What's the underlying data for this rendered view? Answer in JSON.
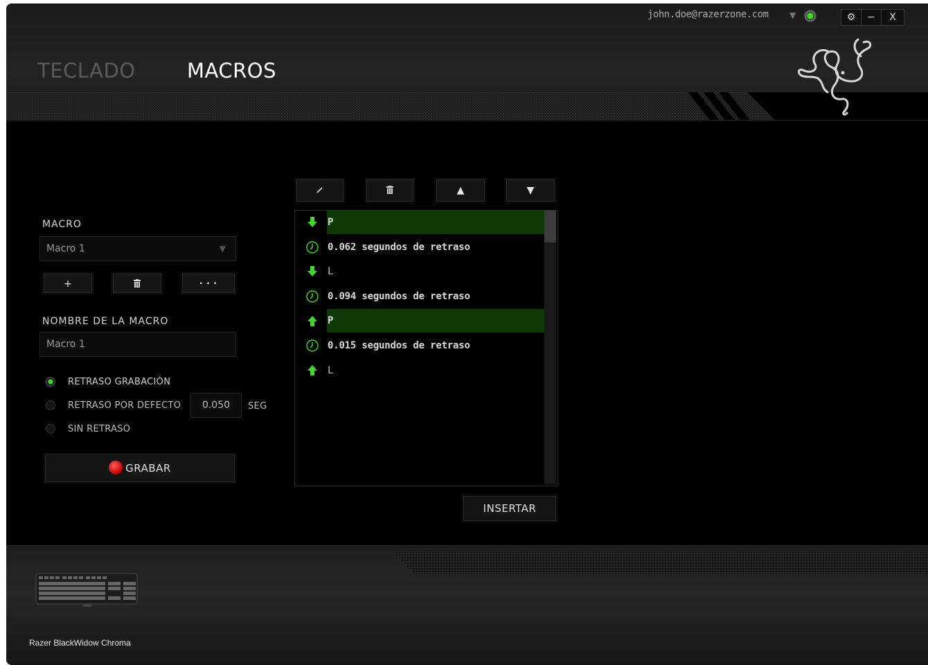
{
  "header": {
    "tabs": [
      {
        "label": "TECLADO",
        "active": false
      },
      {
        "label": "MACROS",
        "active": true
      }
    ],
    "user_email": "john.doe@razerzone.com",
    "window_controls": {
      "settings": "⚙",
      "minimize": "−",
      "close": "X"
    }
  },
  "macro_panel": {
    "macro_label": "MACRO",
    "selected_macro": "Macro 1",
    "add_btn": "+",
    "delete_btn": "🗑",
    "more_btn": "• • •",
    "name_label": "NOMBRE DE LA MACRO",
    "name_value": "Macro 1",
    "delay_options": [
      {
        "label": "RETRASO GRABACIÓN",
        "selected": true
      },
      {
        "label": "RETRASO POR DEFECTO",
        "selected": false
      },
      {
        "label": "SIN RETRASO",
        "selected": false
      }
    ],
    "default_delay_value": "0.050",
    "default_delay_unit": "SEG",
    "record_btn": "GRABAR"
  },
  "event_list": {
    "toolbar": {
      "edit": "✎",
      "delete": "🗑",
      "up": "▲",
      "down": "▼"
    },
    "items": [
      {
        "type": "keydown",
        "text": "P",
        "selected": true
      },
      {
        "type": "delay",
        "text": "0.062 segundos de retraso",
        "selected": false
      },
      {
        "type": "keydown",
        "text": "L",
        "selected": false
      },
      {
        "type": "delay",
        "text": "0.094 segundos de retraso",
        "selected": false
      },
      {
        "type": "keyup",
        "text": "P",
        "selected": true
      },
      {
        "type": "delay",
        "text": "0.015 segundos de retraso",
        "selected": false
      },
      {
        "type": "keyup",
        "text": "L",
        "selected": false
      }
    ],
    "insert_btn": "INSERTAR"
  },
  "footer": {
    "device_name": "Razer BlackWidow Chroma"
  },
  "colors": {
    "accent_green": "#44d62c",
    "selected_row": "#0f3a08",
    "record_red": "#e01010"
  }
}
